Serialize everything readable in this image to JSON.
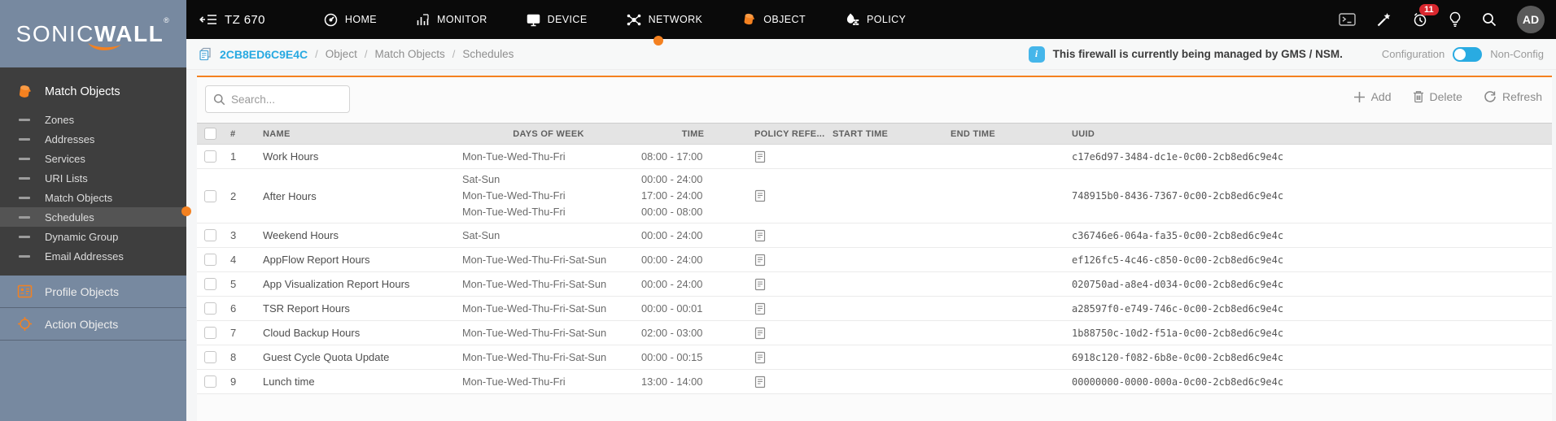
{
  "brand": {
    "logo_main": "SONIC",
    "logo_bold": "WALL",
    "registered": "®"
  },
  "topnav": {
    "device_label": "TZ 670",
    "items": [
      {
        "label": "HOME"
      },
      {
        "label": "MONITOR"
      },
      {
        "label": "DEVICE"
      },
      {
        "label": "NETWORK"
      },
      {
        "label": "OBJECT",
        "active": true
      },
      {
        "label": "POLICY"
      }
    ],
    "notification_count": "11",
    "avatar_initials": "AD"
  },
  "breadcrumb": {
    "device": "2CB8ED6C9E4C",
    "separator": "/",
    "segments": [
      "Object",
      "Match Objects",
      "Schedules"
    ]
  },
  "banner": {
    "message": "This firewall is currently being managed by GMS / NSM.",
    "mode_left": "Configuration",
    "mode_right": "Non-Config"
  },
  "sidebar": {
    "section_title": "Match Objects",
    "items": [
      {
        "label": "Zones",
        "selected": false
      },
      {
        "label": "Addresses",
        "selected": false
      },
      {
        "label": "Services",
        "selected": false
      },
      {
        "label": "URI Lists",
        "selected": false
      },
      {
        "label": "Match Objects",
        "selected": false
      },
      {
        "label": "Schedules",
        "selected": true
      },
      {
        "label": "Dynamic Group",
        "selected": false
      },
      {
        "label": "Email Addresses",
        "selected": false
      }
    ],
    "bottom_sections": [
      {
        "label": "Profile Objects"
      },
      {
        "label": "Action Objects"
      }
    ]
  },
  "toolbar": {
    "search_placeholder": "Search...",
    "add_label": "Add",
    "delete_label": "Delete",
    "refresh_label": "Refresh"
  },
  "table": {
    "columns": [
      "#",
      "NAME",
      "DAYS OF WEEK",
      "TIME",
      "POLICY REFE...",
      "START TIME",
      "END TIME",
      "UUID"
    ],
    "rows": [
      {
        "num": "1",
        "name": "Work Hours",
        "schedules": [
          {
            "days": "Mon-Tue-Wed-Thu-Fri",
            "time": "08:00 - 17:00"
          }
        ],
        "uuid": "c17e6d97-3484-dc1e-0c00-2cb8ed6c9e4c"
      },
      {
        "num": "2",
        "name": "After Hours",
        "schedules": [
          {
            "days": "Sat-Sun",
            "time": "00:00 - 24:00"
          },
          {
            "days": "Mon-Tue-Wed-Thu-Fri",
            "time": "17:00 - 24:00"
          },
          {
            "days": "Mon-Tue-Wed-Thu-Fri",
            "time": "00:00 - 08:00"
          }
        ],
        "uuid": "748915b0-8436-7367-0c00-2cb8ed6c9e4c"
      },
      {
        "num": "3",
        "name": "Weekend Hours",
        "schedules": [
          {
            "days": "Sat-Sun",
            "time": "00:00 - 24:00"
          }
        ],
        "uuid": "c36746e6-064a-fa35-0c00-2cb8ed6c9e4c"
      },
      {
        "num": "4",
        "name": "AppFlow Report Hours",
        "schedules": [
          {
            "days": "Mon-Tue-Wed-Thu-Fri-Sat-Sun",
            "time": "00:00 - 24:00"
          }
        ],
        "uuid": "ef126fc5-4c46-c850-0c00-2cb8ed6c9e4c"
      },
      {
        "num": "5",
        "name": "App Visualization Report Hours",
        "schedules": [
          {
            "days": "Mon-Tue-Wed-Thu-Fri-Sat-Sun",
            "time": "00:00 - 24:00"
          }
        ],
        "uuid": "020750ad-a8e4-d034-0c00-2cb8ed6c9e4c"
      },
      {
        "num": "6",
        "name": "TSR Report Hours",
        "schedules": [
          {
            "days": "Mon-Tue-Wed-Thu-Fri-Sat-Sun",
            "time": "00:00 - 00:01"
          }
        ],
        "uuid": "a28597f0-e749-746c-0c00-2cb8ed6c9e4c"
      },
      {
        "num": "7",
        "name": "Cloud Backup Hours",
        "schedules": [
          {
            "days": "Mon-Tue-Wed-Thu-Fri-Sat-Sun",
            "time": "02:00 - 03:00"
          }
        ],
        "uuid": "1b88750c-10d2-f51a-0c00-2cb8ed6c9e4c"
      },
      {
        "num": "8",
        "name": "Guest Cycle Quota Update",
        "schedules": [
          {
            "days": "Mon-Tue-Wed-Thu-Fri-Sat-Sun",
            "time": "00:00 - 00:15"
          }
        ],
        "uuid": "6918c120-f082-6b8e-0c00-2cb8ed6c9e4c"
      },
      {
        "num": "9",
        "name": "Lunch time",
        "schedules": [
          {
            "days": "Mon-Tue-Wed-Thu-Fri",
            "time": "13:00 - 14:00"
          }
        ],
        "uuid": "00000000-0000-000a-0c00-2cb8ed6c9e4c"
      }
    ]
  },
  "colors": {
    "accent_orange": "#F48120",
    "brand_blue": "#29ABE2",
    "badge_red": "#D9272E"
  }
}
